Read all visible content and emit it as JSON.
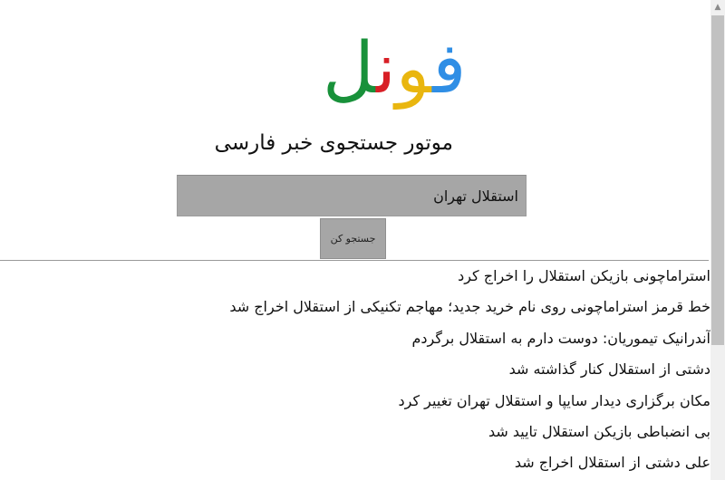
{
  "logo": {
    "letters": [
      {
        "char": "ف",
        "color": "#2f8ee5"
      },
      {
        "char": "و",
        "color": "#e9b60f"
      },
      {
        "char": "ن",
        "color": "#d81f26"
      },
      {
        "char": "ل",
        "color": "#18913a"
      }
    ]
  },
  "tagline": "موتور جستجوی خبر فارسی",
  "search": {
    "value": "استقلال تهران",
    "button_label": "جستجو کن"
  },
  "results": [
    "استراماچونی بازیکن استقلال را اخراج کرد",
    "خط قرمز استراماچونی روی نام خرید جدید؛ مهاجم تکنیکی از استقلال اخراج شد",
    "آندرانیک تیموریان: دوست دارم به استقلال برگردم",
    "دشتی از استقلال کنار گذاشته شد",
    "مکان برگزاری دیدار سایپا و استقلال تهران تغییر کرد",
    "بی انضباطی بازیکن استقلال تایید شد",
    "علی دشتی از استقلال اخراج شد"
  ],
  "colors": {
    "input_bg": "#a6a6a6",
    "divider": "#999999",
    "scrollbar_thumb": "#c1c1c1"
  }
}
